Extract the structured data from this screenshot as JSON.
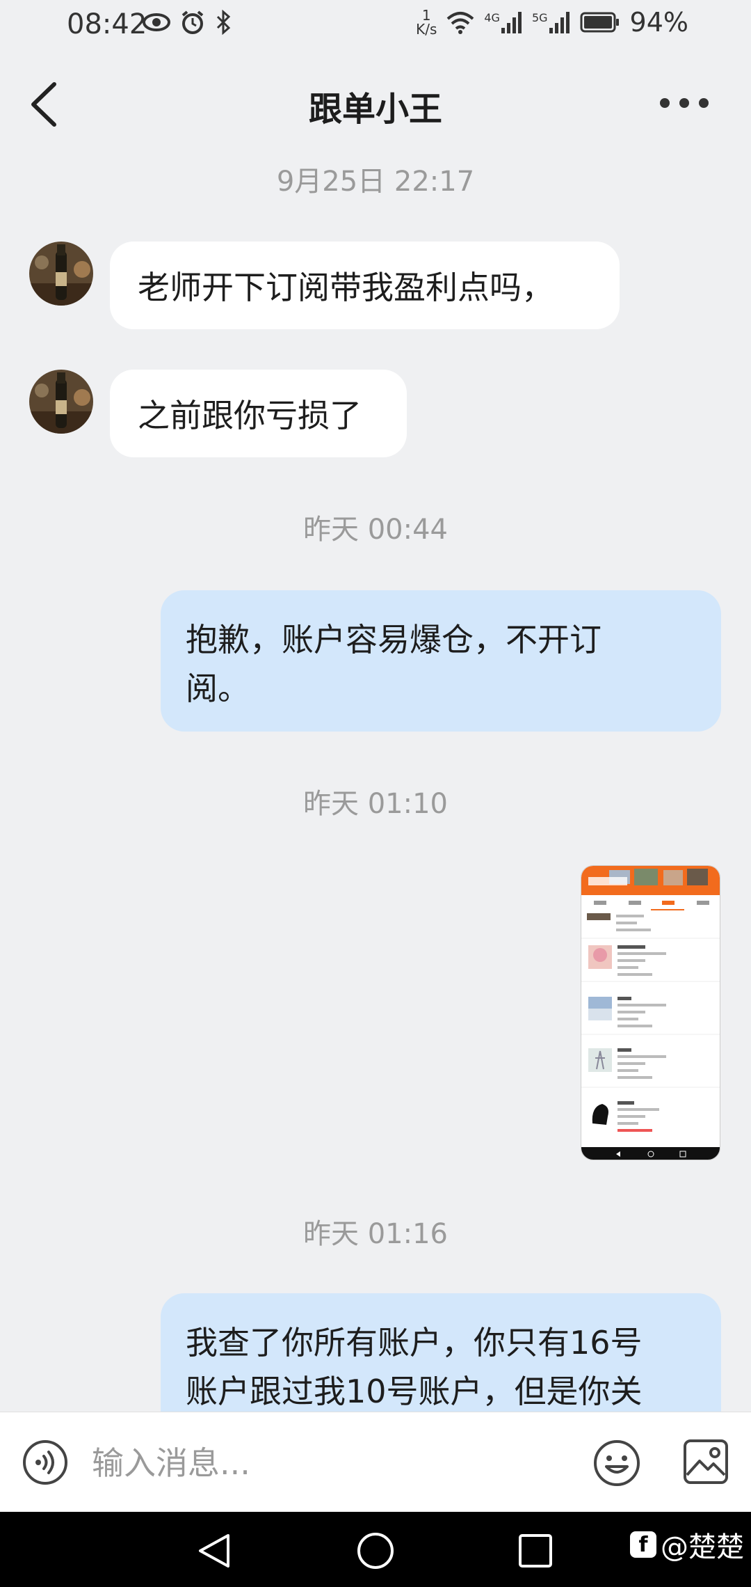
{
  "status_bar": {
    "time": "08:42",
    "net_speed_value": "1",
    "net_speed_unit": "K/s",
    "signal_1": "4G",
    "signal_2": "5G",
    "battery": "94%"
  },
  "header": {
    "title": "跟单小王"
  },
  "messages": [
    {
      "type": "timestamp",
      "text": "9月25日 22:17"
    },
    {
      "type": "incoming",
      "text": "老师开下订阅带我盈利点吗，"
    },
    {
      "type": "incoming",
      "text": "之前跟你亏损了"
    },
    {
      "type": "timestamp",
      "text": "昨天 00:44"
    },
    {
      "type": "outgoing",
      "lines": [
        "抱歉，账户容易爆仓，不开订",
        "阅。"
      ]
    },
    {
      "type": "timestamp",
      "text": "昨天 01:10"
    },
    {
      "type": "outgoing-image",
      "icon": "screenshot-thumbnail"
    },
    {
      "type": "timestamp",
      "text": "昨天 01:16"
    },
    {
      "type": "outgoing",
      "lines": [
        "我查了你所有账户，你只有16号",
        "账户跟过我10号账户，但是你关"
      ]
    }
  ],
  "input_bar": {
    "placeholder": "输入消息..."
  },
  "watermark": {
    "logo": "f",
    "text": "@楚楚"
  },
  "colors": {
    "background": "#eff0f2",
    "outgoing_bubble": "#d3e7fb",
    "incoming_bubble": "#ffffff",
    "accent": "#f26b1d"
  }
}
